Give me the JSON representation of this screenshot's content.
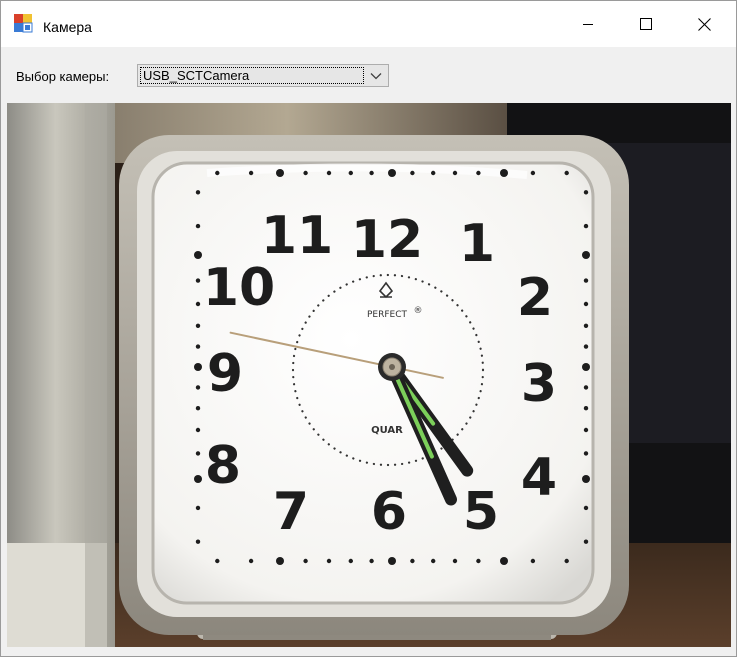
{
  "window": {
    "title": "Камера",
    "icon": "form-icon",
    "buttons": {
      "minimize": "minimize-icon",
      "maximize": "maximize-icon",
      "close": "close-icon"
    }
  },
  "camera_select": {
    "label": "Выбор камеры:",
    "value": "USB_SCTCamera"
  },
  "video_feed": {
    "clock": {
      "numerals": [
        "1",
        "2",
        "3",
        "4",
        "5",
        "6",
        "7",
        "8",
        "9",
        "10",
        "11",
        "12"
      ],
      "brand": "PERFECT",
      "brand_mark": "®",
      "dial_text": "QUAR",
      "time": {
        "hour": 4.8,
        "minute": 26,
        "second": 47
      }
    }
  },
  "colors": {
    "title_bg": "#ffffff",
    "client_bg": "#f0f0f0",
    "clock_case": "#a9a49a",
    "lume": "#7ccf5a"
  }
}
